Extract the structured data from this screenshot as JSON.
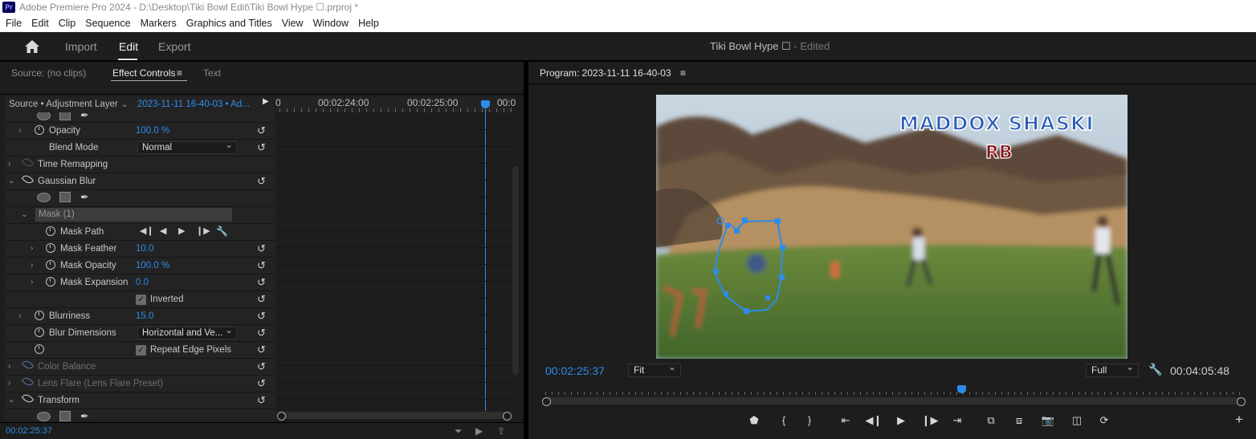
{
  "window": {
    "title": "Adobe Premiere Pro 2024 - D:\\Desktop\\Tiki Bowl Edit\\Tiki Bowl Hype ☐.prproj *",
    "logo_text": "Pr"
  },
  "menu": [
    "File",
    "Edit",
    "Clip",
    "Sequence",
    "Markers",
    "Graphics and Titles",
    "View",
    "Window",
    "Help"
  ],
  "header": {
    "tabs": [
      "Import",
      "Edit",
      "Export"
    ],
    "active_tab": "Edit",
    "project_name": "Tiki Bowl Hype ☐",
    "project_status": "- Edited"
  },
  "left_panel": {
    "tabs": [
      "Source: (no clips)",
      "Effect Controls",
      "Text"
    ],
    "menu_icon": "≡",
    "source_label": "Source • Adjustment Layer",
    "clip_label": "2023-11-11 16-40-03 • Ad...",
    "ruler": {
      "start": "0",
      "t1": "00:02:24:00",
      "t2": "00:02:25:00",
      "t3": "00:0"
    },
    "properties": {
      "opacity": {
        "label": "Opacity",
        "value": "100.0 %"
      },
      "blend_mode": {
        "label": "Blend Mode",
        "value": "Normal"
      },
      "time_remapping": {
        "label": "Time Remapping"
      },
      "gaussian_blur": {
        "label": "Gaussian Blur"
      },
      "mask": {
        "label": "Mask (1)"
      },
      "mask_path": {
        "label": "Mask Path"
      },
      "mask_feather": {
        "label": "Mask Feather",
        "value": "10.0"
      },
      "mask_opacity": {
        "label": "Mask Opacity",
        "value": "100.0 %"
      },
      "mask_expansion": {
        "label": "Mask Expansion",
        "value": "0.0"
      },
      "inverted": {
        "label": "Inverted",
        "checked": true
      },
      "blurriness": {
        "label": "Blurriness",
        "value": "15.0"
      },
      "blur_dimensions": {
        "label": "Blur Dimensions",
        "value": "Horizontal and Ve..."
      },
      "repeat_edge": {
        "label": "Repeat Edge Pixels",
        "checked": true
      },
      "color_balance": {
        "label": "Color Balance"
      },
      "lens_flare": {
        "label": "Lens Flare (Lens Flare Preset)"
      },
      "transform": {
        "label": "Transform"
      }
    },
    "timecode": "00:02:25:37"
  },
  "program_monitor": {
    "title": "Program: 2023-11-11 16-40-03",
    "menu_icon": "≡",
    "overlay_name": "MADDOX SHASKI",
    "overlay_position": "RB",
    "current_timecode": "00:02:25:37",
    "zoom": "Fit",
    "resolution": "Full",
    "duration": "00:04:05:48",
    "playhead_fraction": 0.6
  },
  "icons": {
    "home": "home-icon",
    "wrench": "🔧"
  },
  "colors": {
    "accent": "#2d8ceb",
    "panel_bg": "#1d1d1d",
    "name_title": "#2a5db8",
    "position_title": "#8a0f15"
  }
}
